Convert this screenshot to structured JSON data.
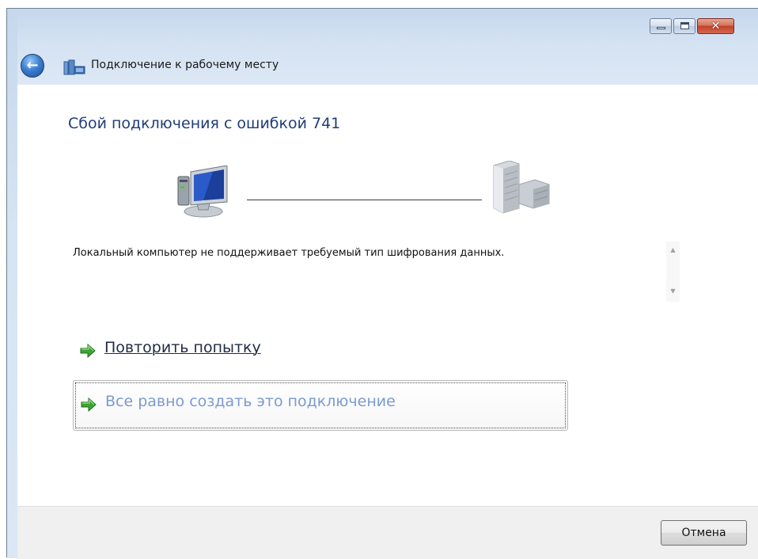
{
  "window": {
    "title": "Подключение к рабочему месту",
    "controls": {
      "minimize_icon": "minimize-icon",
      "maximize_icon": "maximize-icon",
      "close_icon": "close-icon",
      "close_glyph": "✕"
    },
    "back_icon": "back-arrow-icon",
    "back_glyph": "←",
    "app_icon": "workplace-network-icon"
  },
  "main": {
    "heading": "Сбой подключения с ошибкой 741",
    "diagram": {
      "left_icon": "computer-monitor-icon",
      "right_icon": "server-icon"
    },
    "error_message": "Локальный компьютер не поддерживает требуемый тип шифрования данных.",
    "scrollbar": {
      "up_glyph": "▲",
      "down_glyph": "▼"
    },
    "tasks": [
      {
        "label": "Повторить попытку",
        "icon": "green-arrow-icon"
      },
      {
        "label": "Все равно создать это подключение",
        "icon": "green-arrow-icon"
      }
    ]
  },
  "footer": {
    "cancel_label": "Отмена"
  },
  "colors": {
    "heading": "#1f3d78",
    "link_disabled": "#7b9bd0",
    "arrow_green": "#3aa534",
    "titlebar": "#d4e2f2"
  }
}
